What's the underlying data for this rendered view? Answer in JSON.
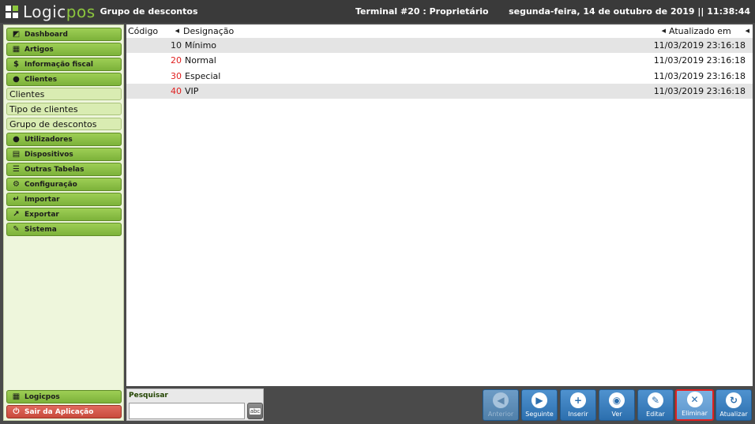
{
  "header": {
    "logo_main": "Logic",
    "logo_accent": "pos",
    "title": "Grupo de descontos",
    "terminal": "Terminal #20 : Proprietário",
    "datetime": "segunda-feira, 14 de outubro de 2019 || 11:38:44"
  },
  "sidebar": {
    "menu": [
      {
        "label": "Dashboard",
        "icon": "dashboard-icon",
        "glyph": "◩"
      },
      {
        "label": "Artigos",
        "icon": "grid-icon",
        "glyph": "▦"
      },
      {
        "label": "Informação fiscal",
        "icon": "coins-icon",
        "glyph": "$"
      },
      {
        "label": "Clientes",
        "icon": "person-icon",
        "glyph": "●"
      }
    ],
    "submenu": [
      "Clientes",
      "Tipo de clientes",
      "Grupo de descontos"
    ],
    "menu2": [
      {
        "label": "Utilizadores",
        "icon": "user-icon",
        "glyph": "●"
      },
      {
        "label": "Dispositivos",
        "icon": "devices-icon",
        "glyph": "▤"
      },
      {
        "label": "Outras Tabelas",
        "icon": "list-icon",
        "glyph": "☰"
      },
      {
        "label": "Configuração",
        "icon": "gears-icon",
        "glyph": "⚙"
      },
      {
        "label": "Importar",
        "icon": "import-icon",
        "glyph": "↵"
      },
      {
        "label": "Exportar",
        "icon": "export-icon",
        "glyph": "↗"
      },
      {
        "label": "Sistema",
        "icon": "wrench-icon",
        "glyph": "✎"
      }
    ],
    "bottom": {
      "logicpos": "Logicpos",
      "exit": "Sair da Aplicação"
    }
  },
  "table": {
    "columns": {
      "code": "Código",
      "name": "Designação",
      "updated": "Atualizado em"
    },
    "rows": [
      {
        "code": "10",
        "name": "Mínimo",
        "updated": "11/03/2019 23:16:18"
      },
      {
        "code": "20",
        "name": "Normal",
        "updated": "11/03/2019 23:16:18"
      },
      {
        "code": "30",
        "name": "Especial",
        "updated": "11/03/2019 23:16:18"
      },
      {
        "code": "40",
        "name": "VIP",
        "updated": "11/03/2019 23:16:18"
      }
    ]
  },
  "search": {
    "label": "Pesquisar",
    "value": "",
    "kbd": "abc"
  },
  "actions": [
    {
      "label": "Anterior",
      "icon": "previous-icon",
      "glyph": "◀",
      "state": "disabled"
    },
    {
      "label": "Seguinte",
      "icon": "next-icon",
      "glyph": "▶",
      "state": "normal"
    },
    {
      "label": "Inserir",
      "icon": "plus-icon",
      "glyph": "+",
      "state": "normal"
    },
    {
      "label": "Ver",
      "icon": "eye-icon",
      "glyph": "◉",
      "state": "normal"
    },
    {
      "label": "Editar",
      "icon": "pencil-icon",
      "glyph": "✎",
      "state": "normal"
    },
    {
      "label": "Eliminar",
      "icon": "delete-icon",
      "glyph": "✕",
      "state": "selected"
    },
    {
      "label": "Atualizar",
      "icon": "refresh-icon",
      "glyph": "↻",
      "state": "normal"
    }
  ]
}
